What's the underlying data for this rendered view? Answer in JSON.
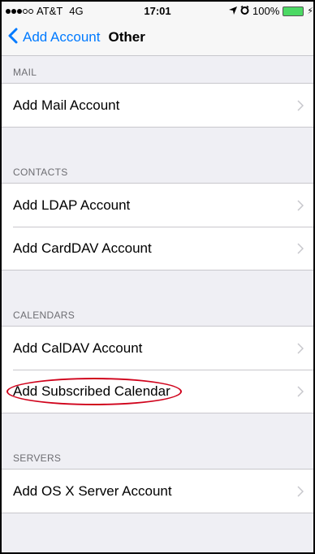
{
  "status_bar": {
    "carrier": "AT&T",
    "network": "4G",
    "time": "17:01",
    "battery_percent": "100%",
    "signal_bars": 3,
    "signal_max": 5,
    "battery_color": "#4cd964"
  },
  "nav": {
    "back_label": "Add Account",
    "title": "Other"
  },
  "sections": {
    "mail": {
      "header": "MAIL",
      "rows": [
        "Add Mail Account"
      ]
    },
    "contacts": {
      "header": "CONTACTS",
      "rows": [
        "Add LDAP Account",
        "Add CardDAV Account"
      ]
    },
    "calendars": {
      "header": "CALENDARS",
      "rows": [
        "Add CalDAV Account",
        "Add Subscribed Calendar"
      ]
    },
    "servers": {
      "header": "SERVERS",
      "rows": [
        "Add OS X Server Account"
      ]
    }
  },
  "colors": {
    "accent": "#007aff",
    "annotation": "#d0021b",
    "background": "#efeff4"
  },
  "icons": [
    "back-chevron-icon",
    "row-chevron-icon",
    "location-arrow-icon",
    "alarm-icon",
    "battery-icon",
    "charging-bolt-icon"
  ]
}
